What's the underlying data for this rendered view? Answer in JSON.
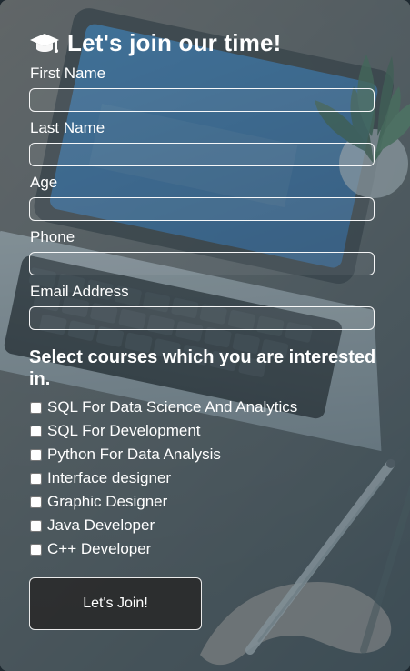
{
  "form": {
    "title": "Let's join our time!",
    "fields": [
      {
        "label": "First Name",
        "value": "",
        "placeholder": ""
      },
      {
        "label": "Last Name",
        "value": "",
        "placeholder": ""
      },
      {
        "label": "Age",
        "value": "",
        "placeholder": ""
      },
      {
        "label": "Phone",
        "value": "",
        "placeholder": ""
      },
      {
        "label": "Email Address",
        "value": "",
        "placeholder": ""
      }
    ],
    "courses_title": "Select courses which you are interested in.",
    "courses": [
      "SQL For Data Science And Analytics",
      "SQL For Development",
      "Python For Data Analysis",
      "Interface designer",
      "Graphic Designer",
      "Java Developer",
      "C++ Developer"
    ],
    "submit_label": "Let's Join!"
  },
  "icons": {
    "title_icon": "graduation-cap-icon"
  }
}
